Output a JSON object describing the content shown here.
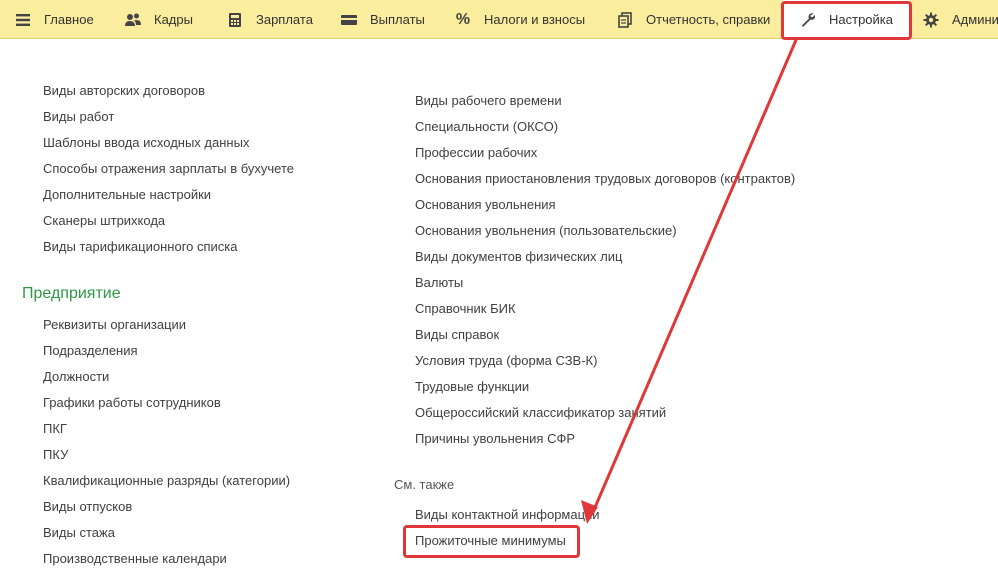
{
  "topbar": {
    "items": [
      {
        "label": "Главное",
        "icon": "hamburger-menu-icon"
      },
      {
        "label": "Кадры",
        "icon": "people-icon"
      },
      {
        "label": "Зарплата",
        "icon": "calculator-icon"
      },
      {
        "label": "Выплаты",
        "icon": "wallet-icon"
      },
      {
        "label": "Налоги и взносы",
        "icon": "percent-icon"
      },
      {
        "label": "Отчетность, справки",
        "icon": "reports-icon"
      },
      {
        "label": "Настройка",
        "icon": "wrench-icon"
      },
      {
        "label": "Админи",
        "icon": "gear-icon"
      }
    ]
  },
  "left_column": {
    "links_top": [
      "Виды авторских договоров",
      "Виды работ",
      "Шаблоны ввода исходных данных",
      "Способы отражения зарплаты в бухучете",
      "Дополнительные настройки",
      "Сканеры штрихкода",
      "Виды тарификационного списка"
    ],
    "section_title": "Предприятие",
    "links_enterprise": [
      "Реквизиты организации",
      "Подразделения",
      "Должности",
      "Графики работы сотрудников",
      "ПКГ",
      "ПКУ",
      "Квалификационные разряды (категории)",
      "Виды отпусков",
      "Виды стажа",
      "Производственные календари"
    ]
  },
  "right_column": {
    "links": [
      "Виды рабочего времени",
      "Специальности (ОКСО)",
      "Профессии рабочих",
      "Основания приостановления трудовых договоров (контрактов)",
      "Основания увольнения",
      "Основания увольнения (пользовательские)",
      "Виды документов физических лиц",
      "Валюты",
      "Справочник БИК",
      "Виды справок",
      "Условия труда (форма СЗВ-К)",
      "Трудовые функции",
      "Общероссийский классификатор занятий",
      "Причины увольнения СФР"
    ],
    "see_also_title": "См. также",
    "see_also_links": [
      "Виды контактной информации",
      "Прожиточные минимумы"
    ]
  },
  "colors": {
    "topbar_bg": "#fbed9e",
    "section_title": "#2b9a45",
    "annotation_red": "#e0383a"
  }
}
